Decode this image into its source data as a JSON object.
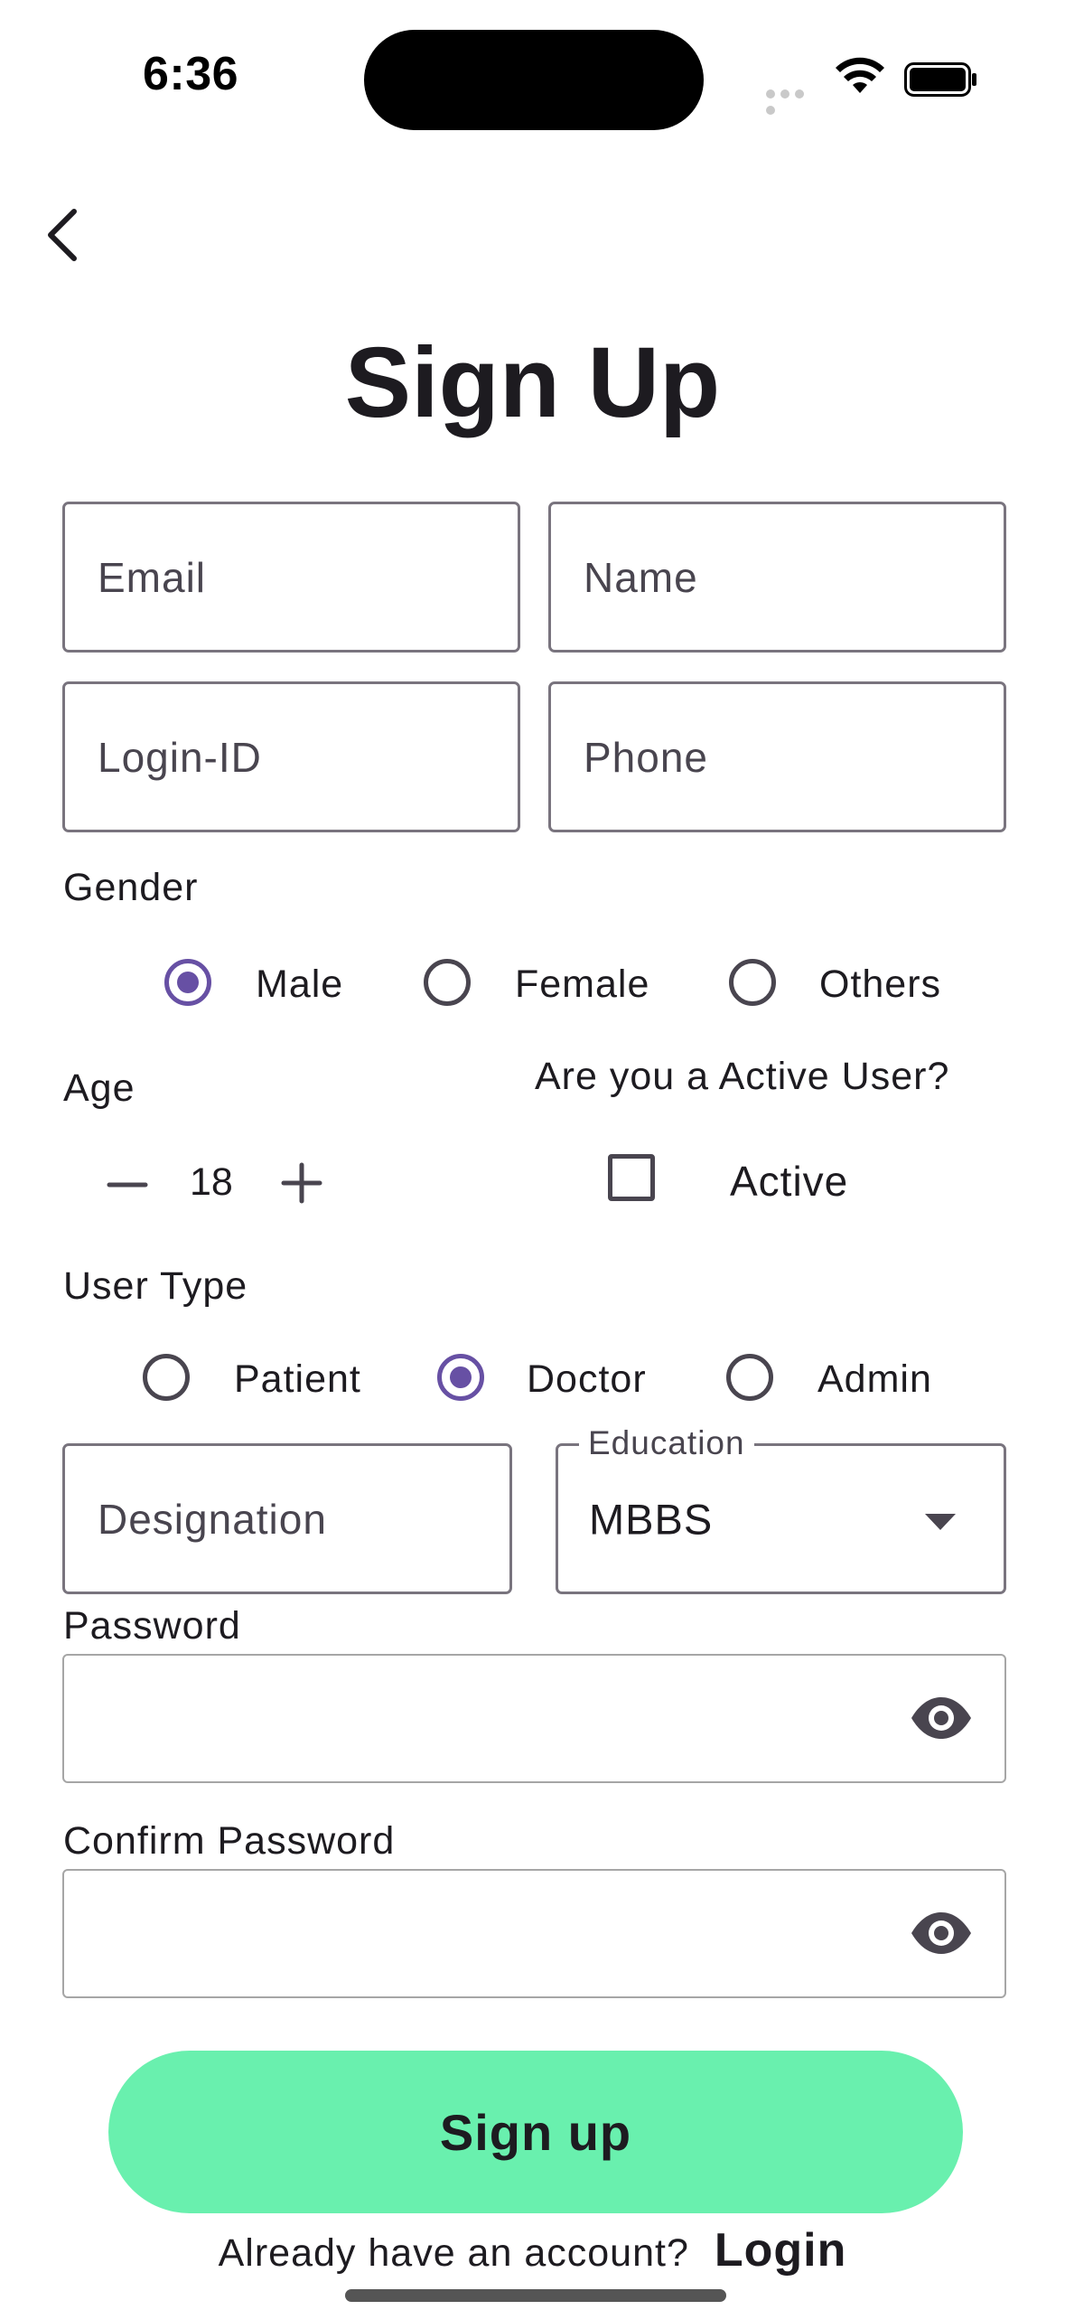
{
  "status_bar": {
    "time": "6:36"
  },
  "page": {
    "title": "Sign Up"
  },
  "fields": {
    "email_placeholder": "Email",
    "name_placeholder": "Name",
    "login_id_placeholder": "Login-ID",
    "phone_placeholder": "Phone",
    "designation_placeholder": "Designation"
  },
  "gender": {
    "label": "Gender",
    "options": [
      "Male",
      "Female",
      "Others"
    ],
    "selected": "Male"
  },
  "age": {
    "label": "Age",
    "value": "18"
  },
  "active_user": {
    "question": "Are you a Active User?",
    "checkbox_label": "Active",
    "checked": false
  },
  "user_type": {
    "label": "User Type",
    "options": [
      "Patient",
      "Doctor",
      "Admin"
    ],
    "selected": "Doctor"
  },
  "education": {
    "legend": "Education",
    "value": "MBBS"
  },
  "password": {
    "label": "Password"
  },
  "confirm_password": {
    "label": "Confirm Password"
  },
  "actions": {
    "signup_label": "Sign up",
    "already_account_text": "Already have an account?",
    "login_label": "Login"
  },
  "colors": {
    "accent": "#6750a4",
    "button": "#69f0ae",
    "outline": "#79747e"
  }
}
